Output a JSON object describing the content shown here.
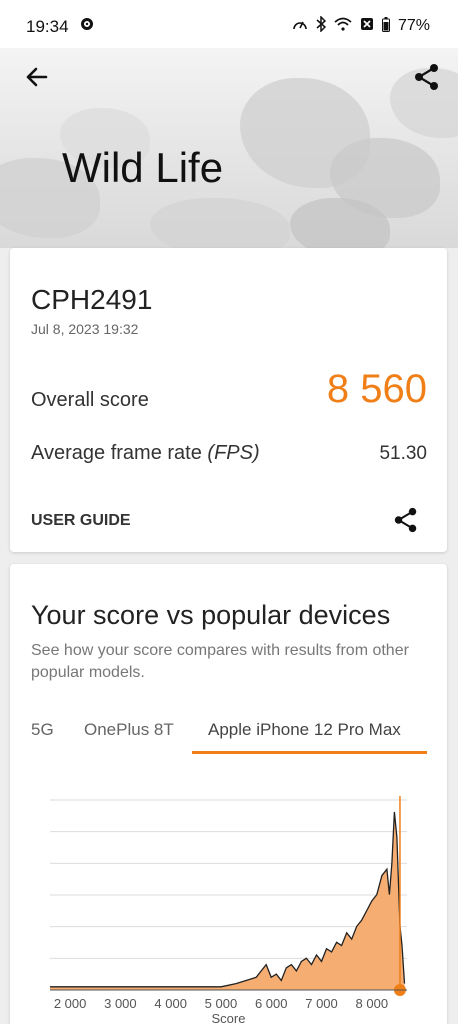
{
  "status": {
    "time": "19:34",
    "battery": "77%"
  },
  "header": {
    "title": "Wild Life"
  },
  "result": {
    "device": "CPH2491",
    "date": "Jul 8, 2023 19:32",
    "overall_label": "Overall score",
    "overall_value": "8 560",
    "fps_label": "Average frame rate",
    "fps_unit": "(FPS)",
    "fps_value": "51.30",
    "guide_label": "USER GUIDE"
  },
  "compare": {
    "title": "Your score vs popular devices",
    "description": "See how your score compares with results from other popular models.",
    "tabs": [
      "5G",
      "OnePlus 8T",
      "Apple iPhone 12 Pro Max"
    ],
    "active_tab": "Apple iPhone 12 Pro Max"
  },
  "colors": {
    "accent": "#f07f18",
    "fill": "#f5ad72"
  },
  "icons": [
    "gear-icon",
    "speed-icon",
    "bluetooth-icon",
    "wifi-icon",
    "battery-icon",
    "back-arrow-icon",
    "share-icon"
  ],
  "chart_data": {
    "type": "area",
    "xlabel": "Score",
    "x_ticks": [
      "2 000",
      "3 000",
      "4 000",
      "5 000",
      "6 000",
      "7 000",
      "8 000"
    ],
    "xlim": [
      1600,
      8700
    ],
    "your_score": 8560,
    "x": [
      1600,
      2000,
      2500,
      3000,
      3500,
      4000,
      4500,
      5000,
      5300,
      5500,
      5700,
      5800,
      5900,
      6000,
      6100,
      6200,
      6300,
      6400,
      6500,
      6600,
      6700,
      6800,
      6900,
      7000,
      7100,
      7200,
      7300,
      7400,
      7500,
      7600,
      7700,
      7800,
      7900,
      8000,
      8100,
      8200,
      8300,
      8350,
      8400,
      8450,
      8500,
      8560,
      8600,
      8650
    ],
    "values": [
      1,
      1,
      1,
      1,
      1,
      1,
      1,
      1,
      2,
      3,
      4,
      6,
      8,
      4,
      5,
      3,
      7,
      8,
      6,
      9,
      10,
      8,
      11,
      9,
      13,
      12,
      15,
      14,
      18,
      16,
      20,
      22,
      25,
      28,
      30,
      36,
      38,
      30,
      40,
      56,
      48,
      20,
      14,
      2
    ]
  }
}
